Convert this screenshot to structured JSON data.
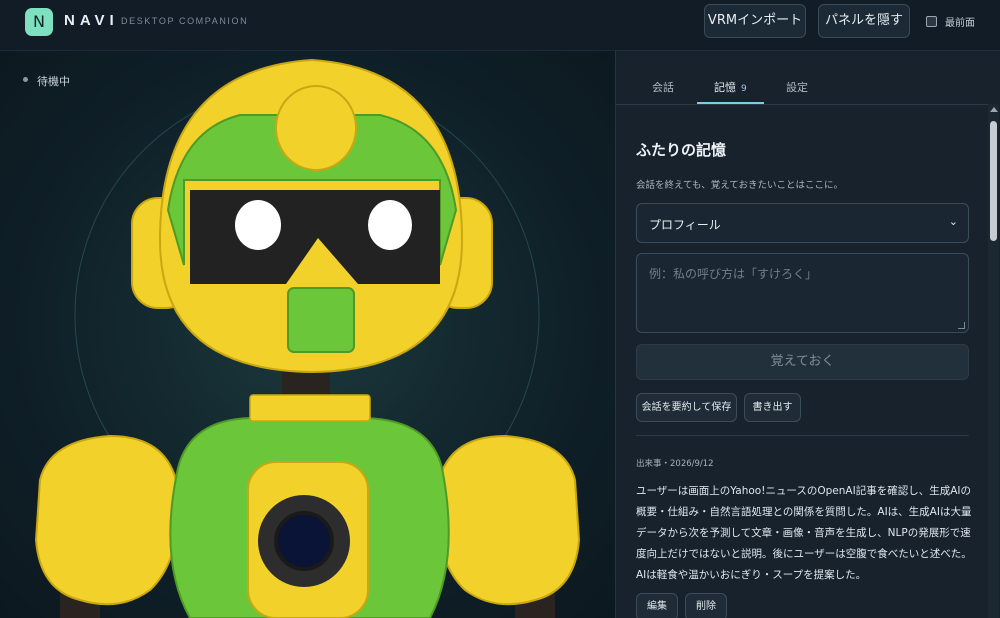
{
  "header": {
    "logo_letter": "N",
    "app_name": "NAVI",
    "app_subtitle": "DESKTOP COMPANION",
    "vrm_import_label": "VRMインポート",
    "hide_panel_label": "パネルを隠す",
    "always_on_top_label": "最前面",
    "always_on_top_checked": false
  },
  "stage": {
    "status": "待機中"
  },
  "panel": {
    "tabs": [
      {
        "label": "会話"
      },
      {
        "label": "記憶",
        "badge": "9",
        "active": true
      },
      {
        "label": "設定"
      }
    ],
    "memory": {
      "title": "ふたりの記憶",
      "description": "会話を終えても、覚えておきたいことはここに。",
      "category_selected": "プロフィール",
      "input_placeholder": "例：私の呼び方は「すけろく」",
      "remember_button": "覚えておく",
      "summarize_button": "会話を要約して保存",
      "export_button": "書き出す",
      "entries": [
        {
          "meta": "出来事・2026/9/12",
          "text": "ユーザーは画面上のYahoo!ニュースのOpenAI記事を確認し、生成AIの概要・仕組み・自然言語処理との関係を質問した。AIは、生成AIは大量データから次を予測して文章・画像・音声を生成し、NLPの発展形で速度向上だけではないと説明。後にユーザーは空腹で食べたいと述べた。AIは軽食や温かいおにぎり・スープを提案した。",
          "edit_label": "編集",
          "delete_label": "削除"
        }
      ]
    }
  },
  "colors": {
    "accent": "#7ccbe8",
    "logo": "#7fe0c0",
    "robot_yellow": "#f2d12a",
    "robot_green": "#6cc63a",
    "visor": "#222222"
  }
}
